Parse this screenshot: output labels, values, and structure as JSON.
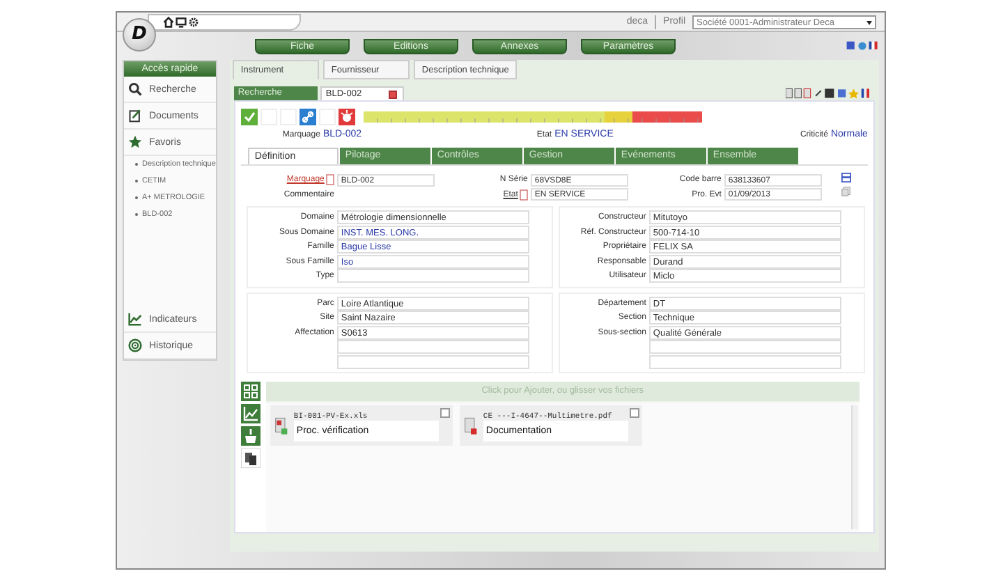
{
  "top_bar": {
    "user": "deca",
    "profile_label": "Profil",
    "profile_value": "Société 0001-Administrateur Deca"
  },
  "logo": "D",
  "menu": [
    {
      "label": "Fiche"
    },
    {
      "label": "Editions"
    },
    {
      "label": "Annexes"
    },
    {
      "label": "Paramètres"
    }
  ],
  "sidebar": {
    "title": "Accès rapide",
    "items": [
      {
        "label": "Recherche",
        "kind": "search"
      },
      {
        "label": "Documents",
        "kind": "documents"
      },
      {
        "label": "Favoris",
        "kind": "favorites",
        "children": [
          {
            "label": "Description technique"
          },
          {
            "label": "CETIM"
          },
          {
            "label": "A+ METROLOGIE"
          },
          {
            "label": "BLD-002"
          }
        ]
      }
    ],
    "bottom_items": [
      {
        "label": "Indicateurs",
        "kind": "chart"
      },
      {
        "label": "Historique",
        "kind": "target"
      }
    ]
  },
  "tabs": [
    {
      "label": "Instrument",
      "selected": true
    },
    {
      "label": "Fournisseur",
      "selected": false
    },
    {
      "label": "Description technique",
      "selected": false
    }
  ],
  "record_tabs": [
    {
      "label": "Recherche",
      "selected": false,
      "closable": false
    },
    {
      "label": "BLD-002",
      "selected": true,
      "closable": true
    }
  ],
  "status_icons": [
    {
      "kind": "check"
    },
    {
      "kind": "empty"
    },
    {
      "kind": "empty"
    },
    {
      "kind": "link"
    },
    {
      "kind": "empty"
    },
    {
      "kind": "alarm"
    }
  ],
  "summary": [
    {
      "label": "Marquage",
      "value": "BLD-002"
    },
    {
      "label": "Etat",
      "value": "EN SERVICE"
    },
    {
      "label": "Criticité",
      "value": "Normale"
    }
  ],
  "section_tabs": [
    {
      "label": "Définition",
      "selected": true
    },
    {
      "label": "Pilotage",
      "selected": false
    },
    {
      "label": "Contrôles",
      "selected": false
    },
    {
      "label": "Gestion",
      "selected": false
    },
    {
      "label": "Evénements",
      "selected": false
    },
    {
      "label": "Ensemble",
      "selected": false
    }
  ],
  "header_columns": [
    [
      {
        "label": "Marquage",
        "kind": "input",
        "link": true,
        "color": "#c0392b",
        "value": "BLD-002"
      },
      {
        "label": "Commentaire",
        "kind": "plain",
        "link": false
      }
    ],
    [
      {
        "label": "N Série",
        "kind": "input",
        "link": false,
        "value": "68VSD8E"
      },
      {
        "label": "Etat",
        "kind": "input",
        "link": true,
        "color": "#444444",
        "value": "EN SERVICE"
      }
    ],
    [
      {
        "label": "Code barre",
        "kind": "input",
        "link": false,
        "value": "638133607"
      },
      {
        "label": "Pro. Evt",
        "kind": "input",
        "link": false,
        "value": "01/09/2013"
      }
    ]
  ],
  "panels": [
    {
      "fields": [
        {
          "kind": "text",
          "label": "Domaine",
          "value": "Métrologie dimensionnelle",
          "linked": false
        },
        {
          "kind": "text",
          "label": "Sous Domaine",
          "value": "INST. MES. LONG.",
          "linked": true
        },
        {
          "kind": "text",
          "label": "Famille",
          "value": "Bague Lisse",
          "linked": true
        },
        {
          "kind": "text",
          "label": "Sous Famille",
          "value": "Iso",
          "linked": true
        },
        {
          "kind": "empty",
          "label": "Type"
        }
      ]
    },
    {
      "fields": [
        {
          "kind": "text",
          "label": "Constructeur",
          "value": "Mitutoyo",
          "linked": false
        },
        {
          "kind": "text",
          "label": "Réf. Constructeur",
          "value": "500-714-10",
          "linked": false
        },
        {
          "kind": "text",
          "label": "Propriétaire",
          "value": "FELIX SA",
          "linked": false
        },
        {
          "kind": "text",
          "label": "Responsable",
          "value": "Durand",
          "linked": false
        },
        {
          "kind": "text",
          "label": "Utilisateur",
          "value": "Miclo",
          "linked": false
        }
      ]
    },
    {
      "fields": [
        {
          "kind": "text",
          "label": "Parc",
          "value": "Loire Atlantique",
          "linked": false
        },
        {
          "kind": "text",
          "label": "Site",
          "value": "Saint Nazaire",
          "linked": false
        },
        {
          "kind": "text",
          "label": "Affectation",
          "value": "S0613",
          "linked": false
        },
        {
          "kind": "empty"
        },
        {
          "kind": "empty"
        }
      ]
    },
    {
      "fields": [
        {
          "kind": "text",
          "label": "Département",
          "value": "DT",
          "linked": false
        },
        {
          "kind": "text",
          "label": "Section",
          "value": "Technique",
          "linked": false
        },
        {
          "kind": "text",
          "label": "Sous-section",
          "value": "Qualité Générale",
          "linked": false
        },
        {
          "kind": "empty"
        },
        {
          "kind": "empty"
        }
      ]
    }
  ],
  "attachments": {
    "drop_hint": "Click pour Ajouter, ou glisser vos fichiers",
    "files": [
      {
        "filename": "BI-001-PV-Ex.xls",
        "title": "Proc. vérification",
        "kind": "spreadsheet",
        "checked": false
      },
      {
        "filename": "CE ---I-4647--Multimetre.pdf",
        "title": "Documentation",
        "kind": "pdf",
        "checked": false
      }
    ]
  }
}
